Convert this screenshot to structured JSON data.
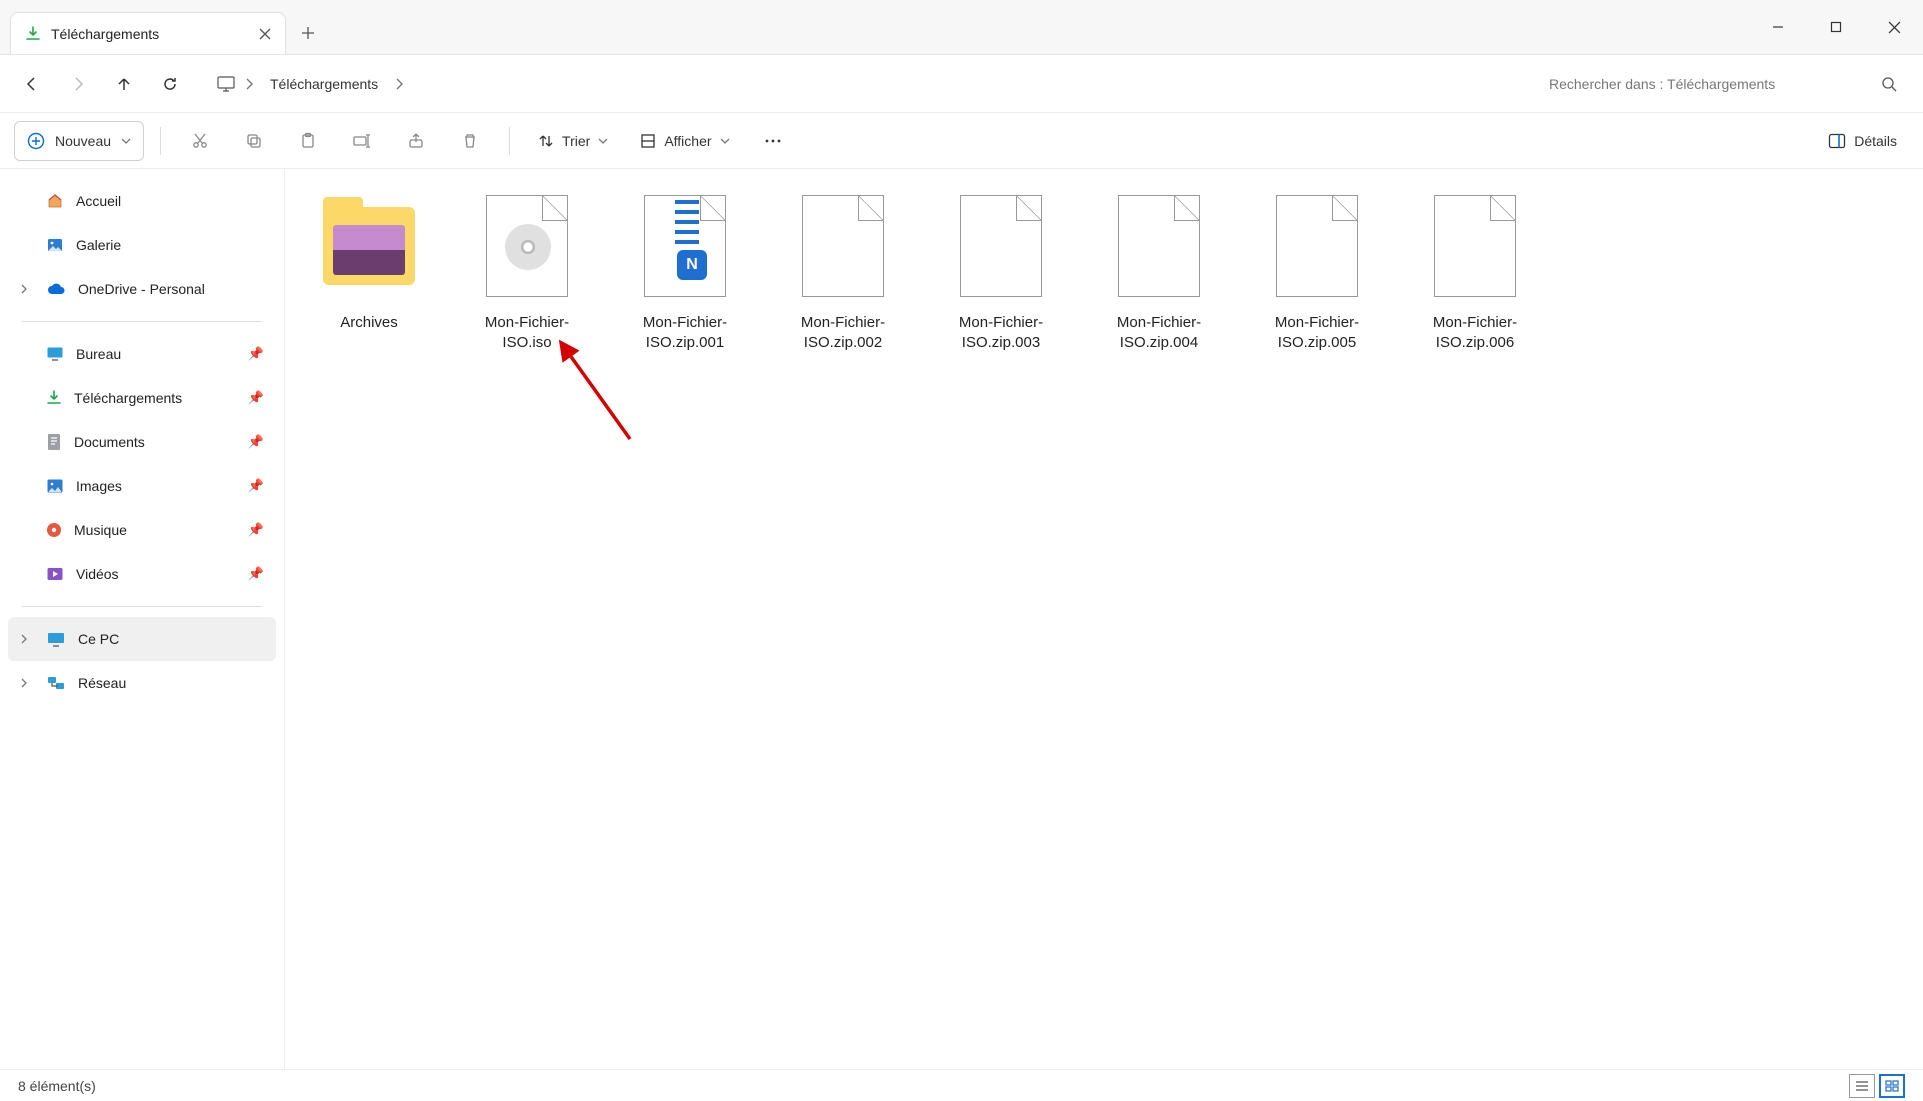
{
  "tab": {
    "title": "Téléchargements"
  },
  "address": {
    "loc": "Téléchargements"
  },
  "search": {
    "placeholder": "Rechercher dans : Téléchargements"
  },
  "toolbar": {
    "new_label": "Nouveau",
    "sort_label": "Trier",
    "view_label": "Afficher",
    "details_label": "Détails"
  },
  "sidebar": {
    "home": "Accueil",
    "gallery": "Galerie",
    "onedrive": "OneDrive - Personal",
    "desktop": "Bureau",
    "downloads": "Téléchargements",
    "documents": "Documents",
    "images": "Images",
    "music": "Musique",
    "videos": "Vidéos",
    "thispc": "Ce PC",
    "network": "Réseau"
  },
  "files": [
    {
      "name": "Archives",
      "type": "folder"
    },
    {
      "name": "Mon-Fichier-ISO.iso",
      "type": "iso"
    },
    {
      "name": "Mon-Fichier-ISO.zip.001",
      "type": "nanazip"
    },
    {
      "name": "Mon-Fichier-ISO.zip.002",
      "type": "generic"
    },
    {
      "name": "Mon-Fichier-ISO.zip.003",
      "type": "generic"
    },
    {
      "name": "Mon-Fichier-ISO.zip.004",
      "type": "generic"
    },
    {
      "name": "Mon-Fichier-ISO.zip.005",
      "type": "generic"
    },
    {
      "name": "Mon-Fichier-ISO.zip.006",
      "type": "generic"
    }
  ],
  "status": {
    "count": "8 élément(s)"
  }
}
